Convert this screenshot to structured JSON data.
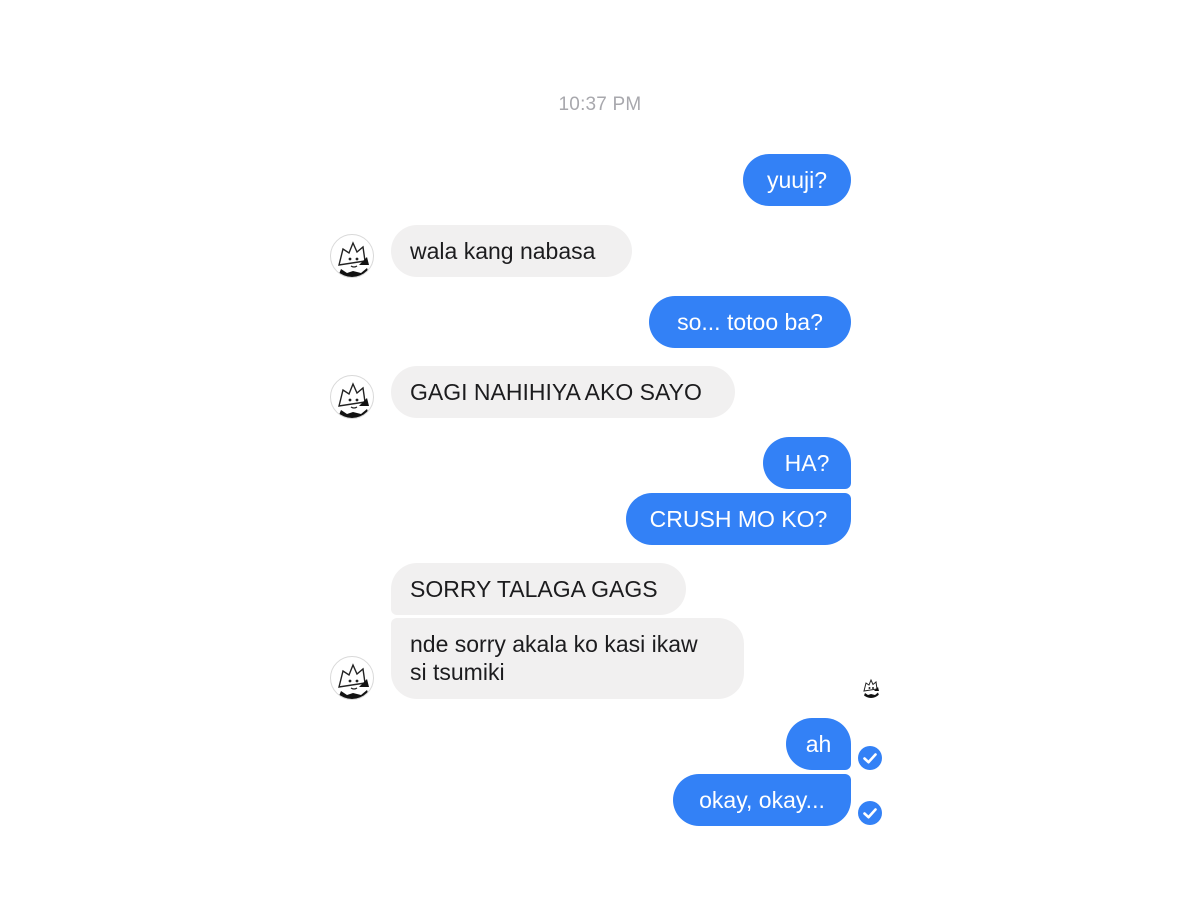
{
  "timestamp": "10:37 PM",
  "messages": [
    {
      "text": "yuuji?"
    },
    {
      "text": "wala kang nabasa"
    },
    {
      "text": "so... totoo ba?"
    },
    {
      "text": "GAGI NAHIHIYA AKO SAYO"
    },
    {
      "text": "HA?"
    },
    {
      "text": "CRUSH MO KO?"
    },
    {
      "text": "SORRY TALAGA GAGS"
    },
    {
      "text_line1": "nde sorry akala ko kasi ikaw",
      "text_line2": "si tsumiki"
    },
    {
      "text": "ah"
    },
    {
      "text": "okay, okay..."
    }
  ],
  "colors": {
    "outgoing_bubble": "#3381f6",
    "incoming_bubble": "#f1f0f0",
    "timestamp_text": "#a8a8ad"
  },
  "icons": {
    "contact_avatar": "manga-avatar-icon",
    "read_receipt": "seen-avatar-icon",
    "delivered": "checkmark-circle-icon"
  }
}
